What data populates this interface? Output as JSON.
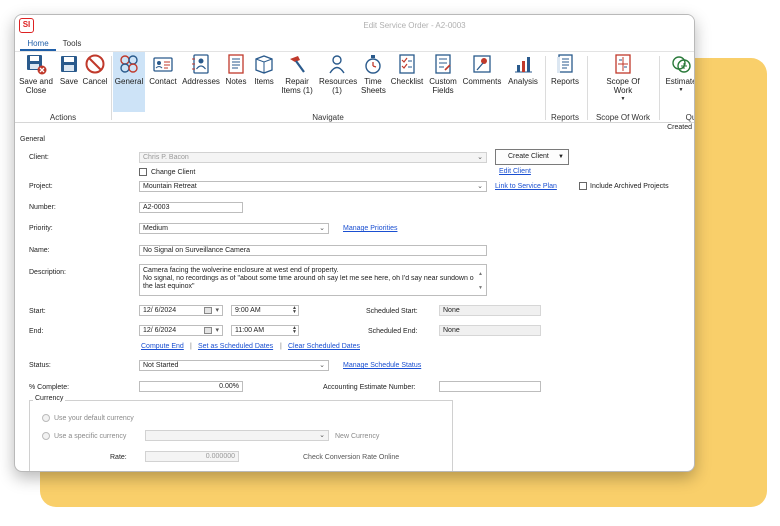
{
  "window": {
    "title": "Edit Service Order - A2-0003",
    "logo_text": "SI"
  },
  "tabs": [
    "Home",
    "Tools"
  ],
  "ribbon": {
    "buttons": {
      "save_close": "Save and Close",
      "save": "Save",
      "cancel": "Cancel",
      "general": "General",
      "contact": "Contact",
      "addresses": "Addresses",
      "notes": "Notes",
      "items": "Items",
      "repair_items": "Repair Items (1)",
      "resources": "Resources (1)",
      "time_sheets": "Time Sheets",
      "checklist": "Checklist",
      "custom_fields": "Custom Fields",
      "comments": "Comments",
      "analysis": "Analysis",
      "reports": "Reports",
      "scope_of_work": "Scope Of Work",
      "estimates": "Estimate"
    },
    "groups": {
      "actions": "Actions",
      "navigate": "Navigate",
      "reports": "Reports",
      "scope": "Scope Of Work",
      "qu": "Qu"
    }
  },
  "strip": {
    "created": "Created"
  },
  "form": {
    "section_title": "General",
    "client_label": "Client:",
    "client_value": "Chris P. Bacon",
    "create_client": "Create Client",
    "change_client": "Change Client",
    "edit_client": "Edit Client",
    "project_label": "Project:",
    "project_value": "Mountain Retreat",
    "link_service_plan": "Link to Service Plan",
    "include_archived": "Include Archived Projects",
    "number_label": "Number:",
    "number_value": "A2-0003",
    "priority_label": "Priority:",
    "priority_value": "Medium",
    "manage_priorities": "Manage Priorities",
    "name_label": "Name:",
    "name_value": "No Signal on Surveillance Camera",
    "description_label": "Description:",
    "description_line1": "Camera facing the wolverine enclosure at west end of property.",
    "description_line2": "No signal, no recordings as of \"about some time around oh say let me see here, oh I'd say near sundown on",
    "description_line3": "the last equinox\"",
    "start_label": "Start:",
    "start_date": "12/  6/2024",
    "start_time": "9:00 AM",
    "end_label": "End:",
    "end_date": "12/  6/2024",
    "end_time": "11:00 AM",
    "scheduled_start_label": "Scheduled Start:",
    "scheduled_start_value": "None",
    "scheduled_end_label": "Scheduled End:",
    "scheduled_end_value": "None",
    "compute_end": "Compute End",
    "set_as_scheduled": "Set as Scheduled Dates",
    "clear_scheduled": "Clear Scheduled Dates",
    "divider": "|",
    "status_label": "Status:",
    "status_value": "Not Started",
    "manage_schedule_status": "Manage Schedule Status",
    "percent_label": "% Complete:",
    "percent_value": "0.00%",
    "accounting_label": "Accounting Estimate Number:",
    "accounting_value": "",
    "currency_title": "Currency",
    "use_default_currency": "Use your default currency",
    "use_specific_currency": "Use a specific currency",
    "new_currency": "New Currency",
    "rate_label": "Rate:",
    "rate_value": "0.000000",
    "check_conversion": "Check Conversion Rate Online"
  },
  "colors": {
    "accent": "#1f5fa8",
    "link": "#1a4fd1",
    "backdrop": "#f9cf6a",
    "icon_red": "#c0392b",
    "icon_blue": "#2a5a8c"
  }
}
